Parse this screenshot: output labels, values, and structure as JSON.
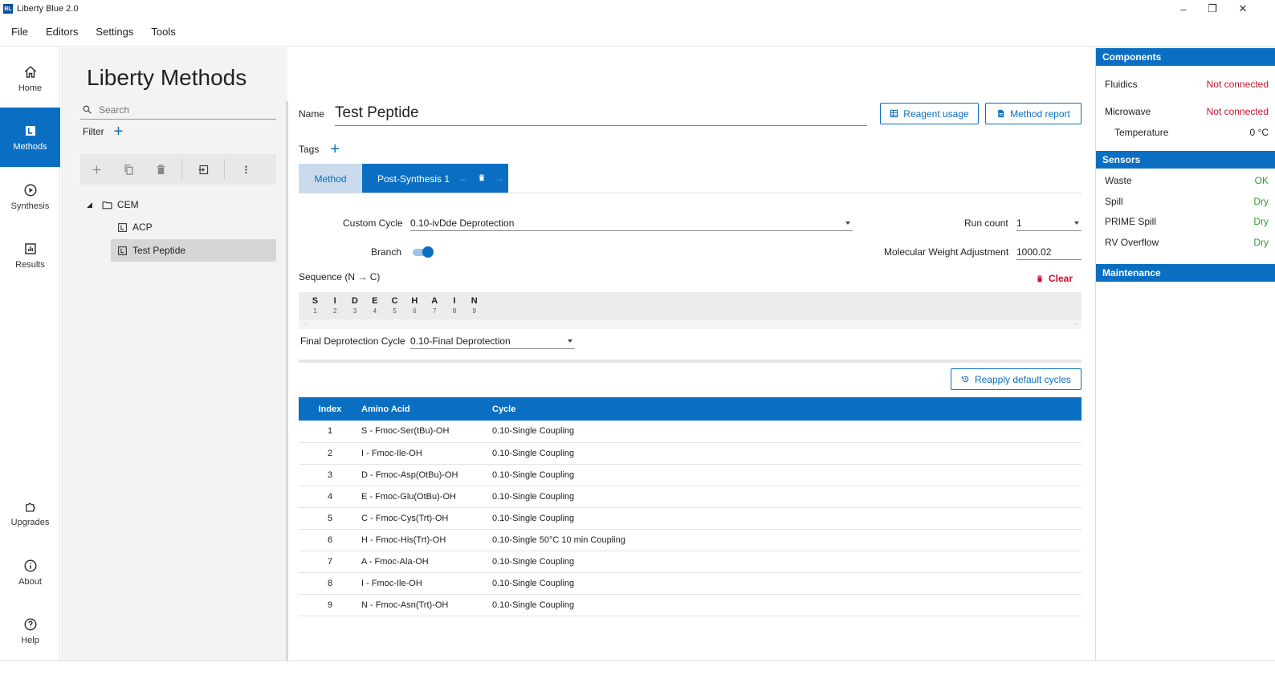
{
  "window": {
    "title": "Liberty Blue 2.0",
    "logo": "BL"
  },
  "menu": [
    "File",
    "Editors",
    "Settings",
    "Tools"
  ],
  "nav": {
    "home": "Home",
    "methods": "Methods",
    "synthesis": "Synthesis",
    "results": "Results",
    "upgrades": "Upgrades",
    "about": "About",
    "help": "Help"
  },
  "left": {
    "title": "Liberty Methods",
    "search_placeholder": "Search",
    "filter_label": "Filter",
    "tree": {
      "folder": "CEM",
      "items": [
        "ACP",
        "Test Peptide"
      ]
    }
  },
  "editor": {
    "name_label": "Name",
    "name_value": "Test Peptide",
    "reagent_button": "Reagent usage",
    "report_button": "Method report",
    "tags_label": "Tags",
    "tab_method": "Method",
    "tab_post": "Post-Synthesis 1",
    "custom_cycle_label": "Custom Cycle",
    "custom_cycle_value": "0.10-ivDde Deprotection",
    "run_count_label": "Run count",
    "run_count_value": "1",
    "branch_label": "Branch",
    "mw_label": "Molecular Weight Adjustment",
    "mw_value": "1000.02",
    "sequence_label": "Sequence (N → C)",
    "clear_button": "Clear",
    "sequence": [
      "S",
      "I",
      "D",
      "E",
      "C",
      "H",
      "A",
      "I",
      "N"
    ],
    "final_deprot_label": "Final Deprotection Cycle",
    "final_deprot_value": "0.10-Final Deprotection",
    "reapply_button": "Reapply default cycles",
    "table": {
      "headers": [
        "Index",
        "Amino Acid",
        "Cycle"
      ],
      "rows": [
        {
          "index": "1",
          "aa": "S - Fmoc-Ser(tBu)-OH",
          "cycle": "0.10-Single Coupling"
        },
        {
          "index": "2",
          "aa": "I - Fmoc-Ile-OH",
          "cycle": "0.10-Single Coupling"
        },
        {
          "index": "3",
          "aa": "D - Fmoc-Asp(OtBu)-OH",
          "cycle": "0.10-Single Coupling"
        },
        {
          "index": "4",
          "aa": "E - Fmoc-Glu(OtBu)-OH",
          "cycle": "0.10-Single Coupling"
        },
        {
          "index": "5",
          "aa": "C - Fmoc-Cys(Trt)-OH",
          "cycle": "0.10-Single Coupling"
        },
        {
          "index": "6",
          "aa": "H - Fmoc-His(Trt)-OH",
          "cycle": "0.10-Single 50°C 10 min Coupling"
        },
        {
          "index": "7",
          "aa": "A - Fmoc-Ala-OH",
          "cycle": "0.10-Single Coupling"
        },
        {
          "index": "8",
          "aa": "I - Fmoc-Ile-OH",
          "cycle": "0.10-Single Coupling"
        },
        {
          "index": "9",
          "aa": "N - Fmoc-Asn(Trt)-OH",
          "cycle": "0.10-Single Coupling"
        }
      ]
    }
  },
  "status": {
    "components_title": "Components",
    "fluidics_label": "Fluidics",
    "fluidics_value": "Not connected",
    "microwave_label": "Microwave",
    "microwave_value": "Not connected",
    "temperature_label": "Temperature",
    "temperature_value": "0 °C",
    "sensors_title": "Sensors",
    "waste_label": "Waste",
    "waste_value": "OK",
    "spill_label": "Spill",
    "spill_value": "Dry",
    "prime_label": "PRIME Spill",
    "prime_value": "Dry",
    "rv_label": "RV Overflow",
    "rv_value": "Dry",
    "maintenance_title": "Maintenance"
  },
  "colors": {
    "accent": "#0a6fc2",
    "error": "#c8102e",
    "ok": "#2e9e2e"
  }
}
